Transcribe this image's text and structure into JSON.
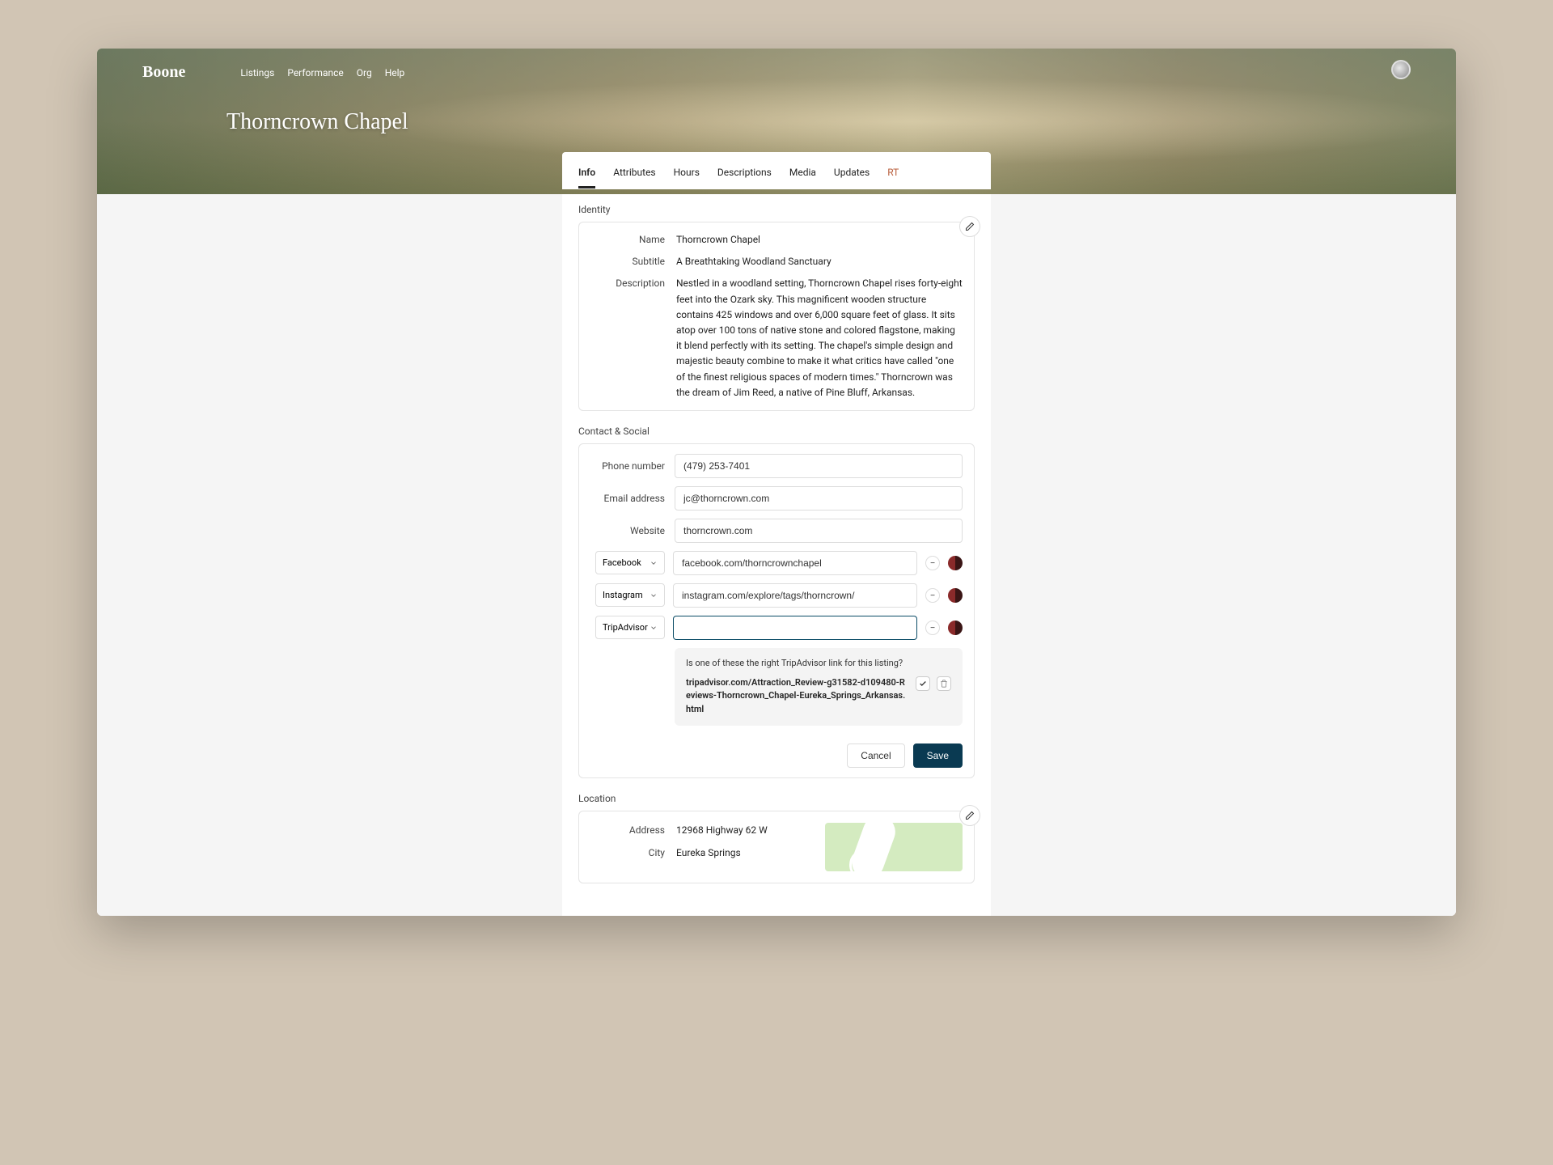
{
  "brand": "Boone",
  "nav": {
    "listings": "Listings",
    "performance": "Performance",
    "org": "Org",
    "help": "Help"
  },
  "page_title": "Thorncrown Chapel",
  "tabs": {
    "info": "Info",
    "attributes": "Attributes",
    "hours": "Hours",
    "descriptions": "Descriptions",
    "media": "Media",
    "updates": "Updates",
    "rt": "RT"
  },
  "identity": {
    "section": "Identity",
    "name_label": "Name",
    "name": "Thorncrown Chapel",
    "subtitle_label": "Subtitle",
    "subtitle": "A Breathtaking Woodland Sanctuary",
    "description_label": "Description",
    "description": "Nestled in a woodland setting, Thorncrown Chapel rises forty-eight feet into the Ozark sky. This magnificent wooden structure contains 425 windows and over 6,000 square feet of glass. It sits atop over 100 tons of native stone and colored flagstone, making it blend perfectly with its setting. The chapel's simple design and majestic beauty combine to make it what critics have called \"one of the finest religious spaces of modern times.\" Thorncrown was the dream of Jim Reed, a native of Pine Bluff, Arkansas."
  },
  "contact": {
    "section": "Contact & Social",
    "phone_label": "Phone number",
    "phone": "(479) 253-7401",
    "email_label": "Email address",
    "email": "jc@thorncrown.com",
    "website_label": "Website",
    "website": "thorncrown.com",
    "socials": [
      {
        "platform": "Facebook",
        "url": "facebook.com/thorncrownchapel"
      },
      {
        "platform": "Instagram",
        "url": "instagram.com/explore/tags/thorncrown/"
      },
      {
        "platform": "TripAdvisor",
        "url": ""
      }
    ],
    "suggest_q": "Is one of these the right TripAdvisor link for this listing?",
    "suggest_link": "tripadvisor.com/Attraction_Review-g31582-d109480-Reviews-Thorncrown_Chapel-Eureka_Springs_Arkansas.html",
    "cancel": "Cancel",
    "save": "Save"
  },
  "location": {
    "section": "Location",
    "address_label": "Address",
    "address": "12968 Highway 62 W",
    "city_label": "City",
    "city": "Eureka Springs"
  }
}
